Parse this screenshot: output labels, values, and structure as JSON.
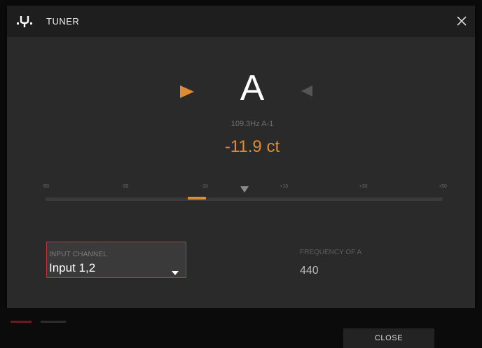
{
  "header": {
    "title": "TUNER",
    "icon": "tuning-fork-icon",
    "close_icon": "close-icon"
  },
  "tuner": {
    "note": "A",
    "frequency_readout": "109.3Hz A-1",
    "cents": "-11.9 ct",
    "cents_value": -11.9,
    "scale_labels": [
      "-50",
      "-30",
      "-10",
      "+10",
      "+30",
      "+50"
    ],
    "scale_min": -50,
    "scale_max": 50,
    "sharp_indicator": "off",
    "flat_indicator": "on"
  },
  "input_channel": {
    "label": "INPUT CHANNEL",
    "value": "Input 1,2"
  },
  "frequency_of_a": {
    "label": "FREQUENCY OF A",
    "value": "440"
  },
  "footer": {
    "close_label": "CLOSE"
  },
  "colors": {
    "accent": "#e08b33",
    "focus_border": "#c0323e",
    "dialog_bg": "#2a2a2b",
    "titlebar_bg": "#1e1e1f",
    "inactive_arrow": "#555555"
  }
}
